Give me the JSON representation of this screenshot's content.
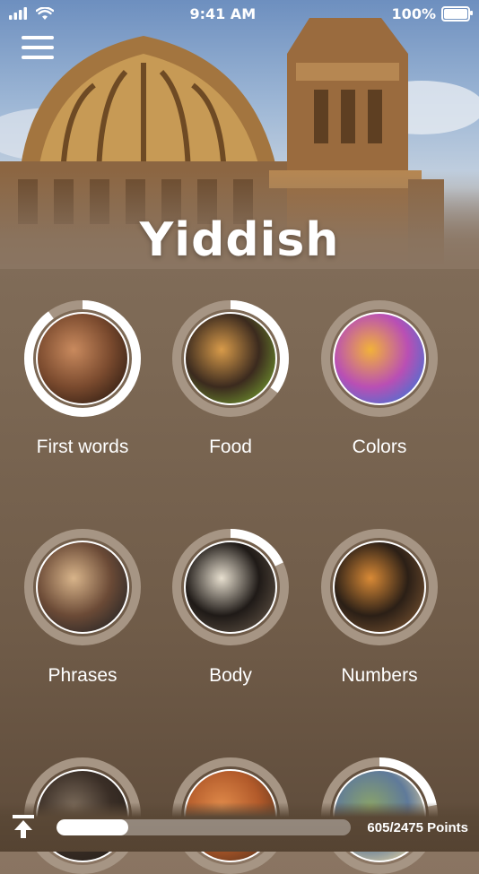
{
  "status_bar": {
    "time": "9:41 AM",
    "battery_text": "100%",
    "signal_icon": "signal-bars-icon",
    "wifi_icon": "wifi-icon",
    "battery_icon": "battery-icon"
  },
  "header": {
    "title": "Yiddish",
    "menu_icon": "hamburger-menu-icon"
  },
  "categories": [
    {
      "label": "First words",
      "progress": 0.9,
      "image": "child-face"
    },
    {
      "label": "Food",
      "progress": 0.35,
      "image": "burger-fries"
    },
    {
      "label": "Colors",
      "progress": 0.0,
      "image": "color-powder"
    },
    {
      "label": "Phrases",
      "progress": 0.0,
      "image": "couple-smiling"
    },
    {
      "label": "Body",
      "progress": 0.18,
      "image": "skeleton"
    },
    {
      "label": "Numbers",
      "progress": 0.0,
      "image": "wooden-digits"
    },
    {
      "label": "",
      "progress": 0.0,
      "image": "partial-1"
    },
    {
      "label": "",
      "progress": 0.0,
      "image": "partial-2"
    },
    {
      "label": "",
      "progress": 0.22,
      "image": "partial-3"
    }
  ],
  "footer": {
    "points_text": "605/2475 Points",
    "progress": 0.2444,
    "upload_icon": "upload-to-top-icon"
  },
  "colors": {
    "background": "#7d6955",
    "ring_track": "#a69584",
    "ring_fill": "#ffffff"
  }
}
